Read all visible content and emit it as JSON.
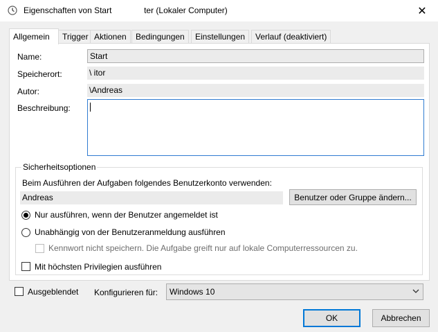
{
  "window": {
    "title": "Eigenschaften von Start              ter (Lokaler Computer)",
    "close_glyph": "✕"
  },
  "tabs": [
    {
      "label": "Allgemein",
      "active": true
    },
    {
      "label": "Trigger"
    },
    {
      "label": "Aktionen"
    },
    {
      "label": "Bedingungen"
    },
    {
      "label": "Einstellungen"
    },
    {
      "label": "Verlauf (deaktiviert)"
    }
  ],
  "general": {
    "name_label": "Name:",
    "name_value": "Start",
    "location_label": "Speicherort:",
    "location_value": "\\              itor",
    "author_label": "Autor:",
    "author_value": "\\Andreas",
    "description_label": "Beschreibung:"
  },
  "security": {
    "group_title": "Sicherheitsoptionen",
    "account_prompt": "Beim Ausführen der Aufgaben folgendes Benutzerkonto verwenden:",
    "account_value": "Andreas",
    "change_user_button": "Benutzer oder Gruppe ändern...",
    "radio_logged_on": "Nur ausführen, wenn der Benutzer angemeldet ist",
    "radio_independent": "Unabhängig von der Benutzeranmeldung ausführen",
    "no_store_password": "Kennwort nicht speichern. Die Aufgabe greift nur auf lokale Computerressourcen zu.",
    "highest_privileges": "Mit höchsten Privilegien ausführen"
  },
  "bottom": {
    "hidden_label": "Ausgeblendet",
    "configure_label": "Konfigurieren für:",
    "configure_value": "Windows 10"
  },
  "buttons": {
    "ok": "OK",
    "cancel": "Abbrechen"
  },
  "colors": {
    "focus_blue": "#0078d7",
    "dialog_bg": "#f0f0f0"
  }
}
